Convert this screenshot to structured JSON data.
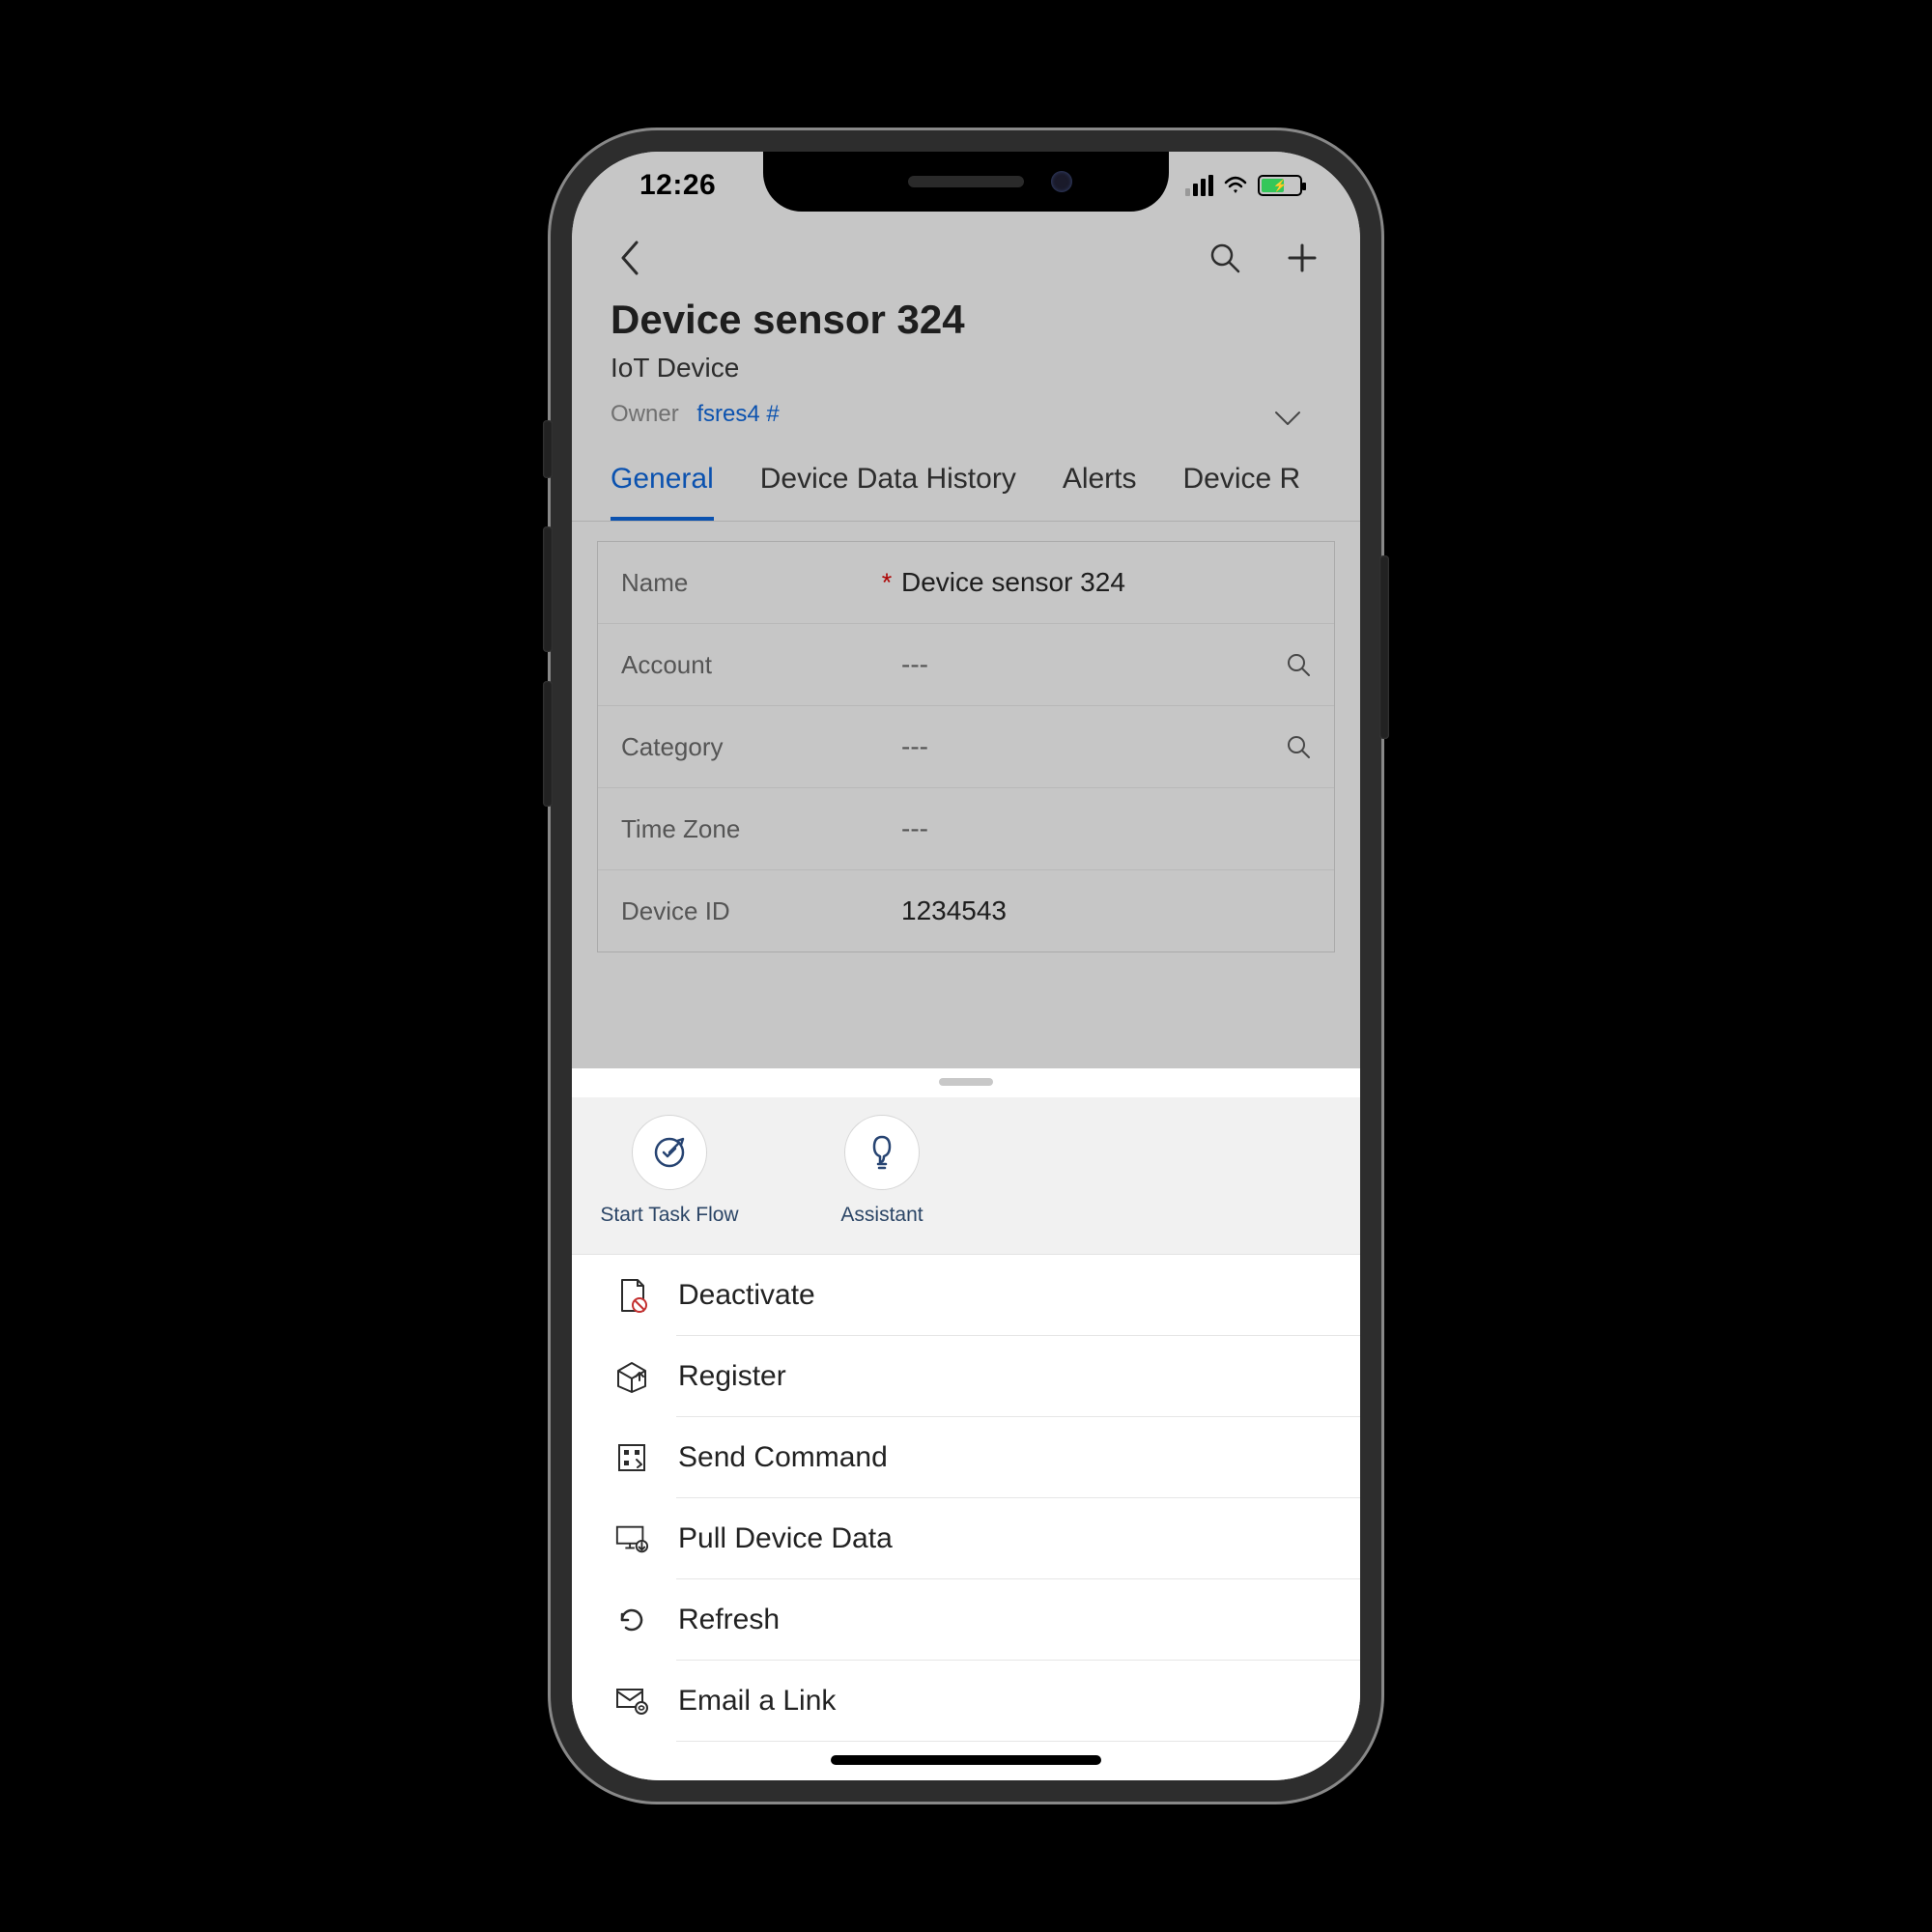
{
  "status": {
    "time": "12:26"
  },
  "header": {
    "title": "Device sensor 324",
    "subtitle": "IoT Device",
    "owner_label": "Owner",
    "owner_value": "fsres4 #"
  },
  "tabs": [
    {
      "label": "General"
    },
    {
      "label": "Device Data History"
    },
    {
      "label": "Alerts"
    },
    {
      "label": "Device R"
    }
  ],
  "fields": {
    "name": {
      "label": "Name",
      "value": "Device sensor 324",
      "required": "*"
    },
    "account": {
      "label": "Account",
      "value": "---"
    },
    "category": {
      "label": "Category",
      "value": "---"
    },
    "timezone": {
      "label": "Time Zone",
      "value": "---"
    },
    "deviceid": {
      "label": "Device ID",
      "value": "1234543"
    }
  },
  "sheet": {
    "quick": [
      {
        "label": "Start Task Flow"
      },
      {
        "label": "Assistant"
      }
    ],
    "items": [
      {
        "label": "Deactivate"
      },
      {
        "label": "Register"
      },
      {
        "label": "Send Command"
      },
      {
        "label": "Pull Device Data"
      },
      {
        "label": "Refresh"
      },
      {
        "label": "Email a Link"
      }
    ]
  }
}
